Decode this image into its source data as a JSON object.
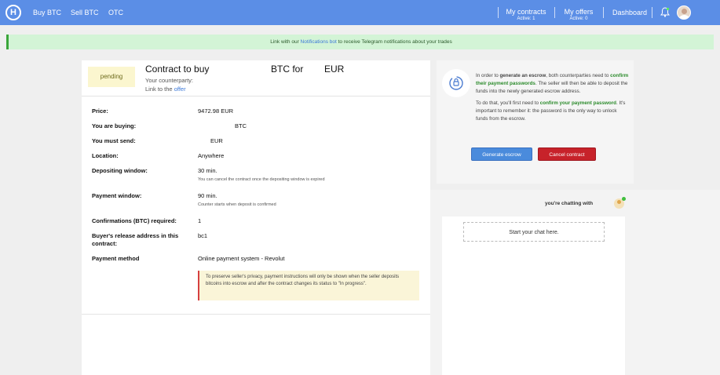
{
  "nav": {
    "logo": "H",
    "links": [
      "Buy BTC",
      "Sell BTC",
      "OTC"
    ],
    "my_contracts": "My contracts",
    "my_contracts_sub": "Active: 1",
    "my_offers": "My offers",
    "my_offers_sub": "Active: 0",
    "dashboard": "Dashboard"
  },
  "banner": {
    "pre": "Link with our ",
    "link": "Notifications bot",
    "post": " to receive Telegram notifications about your trades"
  },
  "contract": {
    "status": "pending",
    "title_contract": "Contract to buy",
    "title_btc_for": "BTC for",
    "title_currency": "EUR",
    "counterparty_label": "Your counterparty:",
    "link_label": "Link to the ",
    "link_offer": "offer"
  },
  "details": [
    {
      "label": "Price:",
      "value": "9472.98 EUR",
      "note": ""
    },
    {
      "label": "You are buying:",
      "value": "BTC",
      "note": ""
    },
    {
      "label": "You must send:",
      "value": "EUR",
      "note": ""
    },
    {
      "label": "Location:",
      "value": "Anywhere",
      "note": ""
    },
    {
      "label": "Depositing window:",
      "value": "30 min.",
      "note": "You can cancel the contract once the depositing window is expired"
    },
    {
      "label": "Payment window:",
      "value": "90 min.",
      "note": "Counter starts when deposit is confirmed"
    },
    {
      "label": "Confirmations (BTC) required:",
      "value": "1",
      "note": ""
    },
    {
      "label": "Buyer's release address in this",
      "label2": "contract:",
      "value": "bc1",
      "note": ""
    },
    {
      "label": "Payment method",
      "value": "Online payment system - Revolut",
      "note": ""
    }
  ],
  "warning": "To preserve seller's privacy, payment instructions will only be shown when the seller deposits bitcoins into escrow and after the contract changes its status to \"In progress\".",
  "escrow": {
    "p1_a": "In order to ",
    "p1_b": "generate an escrow",
    "p1_c": ", both counterparties need to ",
    "p1_d": "confirm their payment passwords",
    "p1_e": ". The seller will then be able to deposit the funds into the newly generated escrow address.",
    "p2_a": "To do that, you'll first need to ",
    "p2_b": "confirm your payment password",
    "p2_c": ". It's important to remember it: the password is the only way to unlock funds from the escrow.",
    "generate_btn": "Generate escrow",
    "cancel_btn": "Cancel contract"
  },
  "chat": {
    "title": "you're chatting with",
    "start": "Start your chat here."
  },
  "colors": {
    "nav": "#5b8ee6",
    "banner": "#d3f4d6",
    "pending": "#fbf6cf",
    "generate": "#4a8bdc",
    "cancel": "#c7222a",
    "highlight_green": "#2a8a2a"
  }
}
